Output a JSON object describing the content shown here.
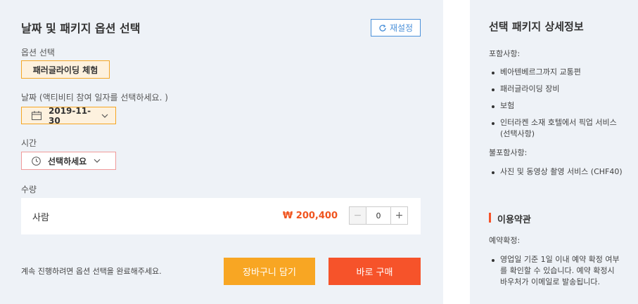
{
  "options": {
    "title": "날짜 및 패키지 옵션 선택",
    "reset_label": "재설정",
    "option_label": "옵션 선택",
    "option_chip": "패러글라이딩 체험",
    "date_label": "날짜  (액티비티 참여 일자를 선택하세요. )",
    "date_value": "2019-11-30",
    "time_label": "시간",
    "time_value": "선택하세요",
    "qty_label": "수량",
    "qty_person": "사람",
    "qty_price": "₩ 200,400",
    "qty_value": "0",
    "notice": "계속 진행하려면 옵션 선택을 완료해주세요.",
    "cart_button": "장바구니 담기",
    "buy_button": "바로 구매"
  },
  "details": {
    "title": "선택 패키지 상세정보",
    "included_label": "포함사항:",
    "included": [
      "베아텐베르그까지 교통편",
      "패러글라이딩 장비",
      "보험",
      "인터라켄 소재 호텔에서 픽업 서비스 (선택사항)"
    ],
    "excluded_label": "불포함사항:",
    "excluded": [
      "사진 및 동영상 촬영 서비스 (CHF40)"
    ],
    "terms_title": "이용약관",
    "booking_label": "예약확정:",
    "booking": [
      "영업일 기준 1일 이내 예약 확정 여부를 확인할 수 있습니다. 예약 확정시 바우처가 이메일로 발송됩니다."
    ]
  },
  "colors": {
    "accent_orange": "#f8a623",
    "accent_red": "#f6532a",
    "link_blue": "#4a90d9"
  }
}
